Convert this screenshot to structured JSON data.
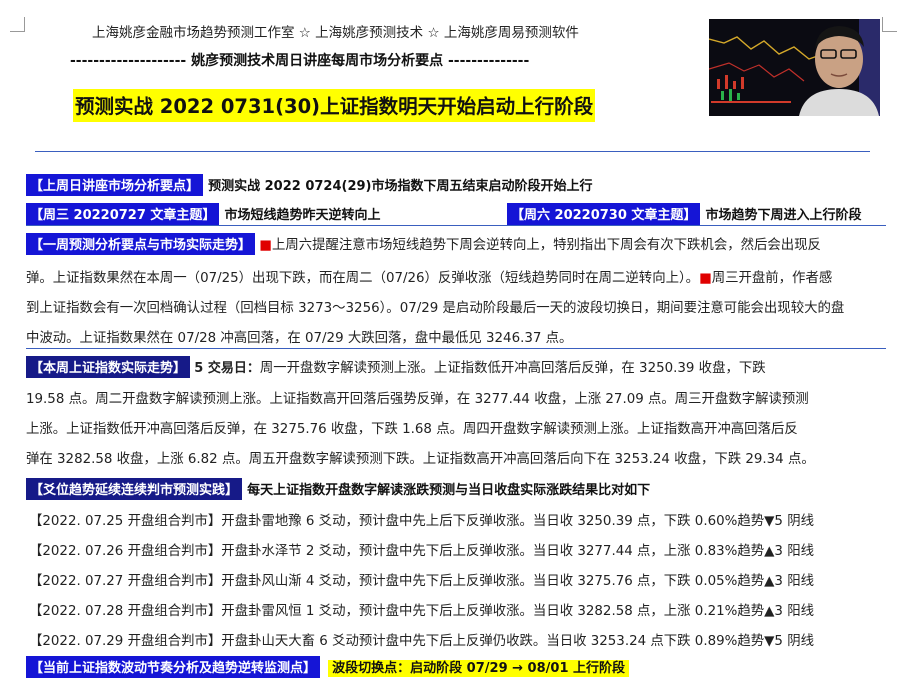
{
  "header": {
    "studio_line": "上海姚彦金融市场趋势预测工作室 ☆ 上海姚彦预测技术 ☆ 上海姚彦周易预测软件",
    "subtitle_line": "-------------------- 姚彦预测技术周日讲座每周市场分析要点 --------------",
    "main_title": "预测实战 2022 0731(30)上证指数明天开始启动上行阶段"
  },
  "last_week": {
    "tag": "【上周日讲座市场分析要点】",
    "text": "预测实战 2022 0724(29)市场指数下周五结束启动阶段开始上行"
  },
  "articles": {
    "wed_tag": "【周三 20220727 文章主题】",
    "wed_text": "市场短线趋势昨天逆转向上",
    "sat_tag": "【周六 20220730 文章主题】",
    "sat_text": "市场趋势下周进入上行阶段"
  },
  "week_forecast": {
    "tag": "【一周预测分析要点与市场实际走势】",
    "marker1": "■",
    "line1": "上周六提醒注意市场短线趋势下周会逆转向上，特别指出下周会有次下跌机会，然后会出现反",
    "line2a": "弹。上证指数果然在本周一（07/25）出现下跌，而在周二（07/26）反弹收涨（短线趋势同时在周二逆转向上）。",
    "marker2": "■",
    "line2b": "周三开盘前，作者感",
    "line3": "到上证指数会有一次回档确认过程（回档目标 3273～3256）。07/29 是启动阶段最后一天的波段切换日，期间要注意可能会出现较大的盘",
    "line4": "中波动。上证指数果然在 07/28 冲高回落，在 07/29 大跌回落，盘中最低见 3246.37 点。"
  },
  "weekly_actual": {
    "tag": "【本周上证指数实际走势】",
    "lead": "5 交易日：",
    "line1": "周一开盘数字解读预测上涨。上证指数低开冲高回落后反弹，在 3250.39 收盘，下跌",
    "line2": "19.58 点。周二开盘数字解读预测上涨。上证指数高开回落后强势反弹，在 3277.44 收盘，上涨 27.09 点。周三开盘数字解读预测",
    "line3": "上涨。上证指数低开冲高回落后反弹，在 3275.76 收盘，下跌 1.68 点。周四开盘数字解读预测上涨。上证指数高开冲高回落后反",
    "line4": "弹在 3282.58 收盘，上涨 6.82 点。周五开盘数字解读预测下跌。上证指数高开冲高回落后向下在 3253.24 收盘，下跌 29.34 点。"
  },
  "hexagram": {
    "tag": "【爻位趋势延续连续判市预测实践】",
    "heading": "每天上证指数开盘数字解读涨跌预测与当日收盘实际涨跌结果比对如下",
    "rows": [
      "【2022. 07.25 开盘组合判市】开盘卦雷地豫 6 爻动，预计盘中先上后下反弹收涨。当日收 3250.39 点，下跌 0.60%趋势▼5 阴线",
      "【2022. 07.26 开盘组合判市】开盘卦水泽节 2 爻动，预计盘中先下后上反弹收涨。当日收 3277.44 点，上涨 0.83%趋势▲3 阳线",
      "【2022. 07.27 开盘组合判市】开盘卦风山渐 4 爻动，预计盘中先下后上反弹收涨。当日收 3275.76 点，下跌 0.05%趋势▲3 阳线",
      "【2022. 07.28 开盘组合判市】开盘卦雷风恒 1 爻动，预计盘中先下后上反弹收涨。当日收 3282.58 点，上涨 0.21%趋势▲3 阳线",
      "【2022. 07.29 开盘组合判市】开盘卦山天大畜 6 爻动预计盘中先下后上反弹仍收跌。当日收 3253.24 点下跌 0.89%趋势▼5 阴线"
    ]
  },
  "bottom": {
    "tag": "【当前上证指数波动节奏分析及趋势逆转监测点】",
    "highlight": "波段切换点：启动阶段 07/29 → 08/01 上行阶段"
  },
  "colors": {
    "tag_blue": "#1515d6",
    "tag_dark": "#161a88",
    "highlight": "#ffff00",
    "marker_red": "#e00000",
    "rule_blue": "#3a5fbf"
  }
}
